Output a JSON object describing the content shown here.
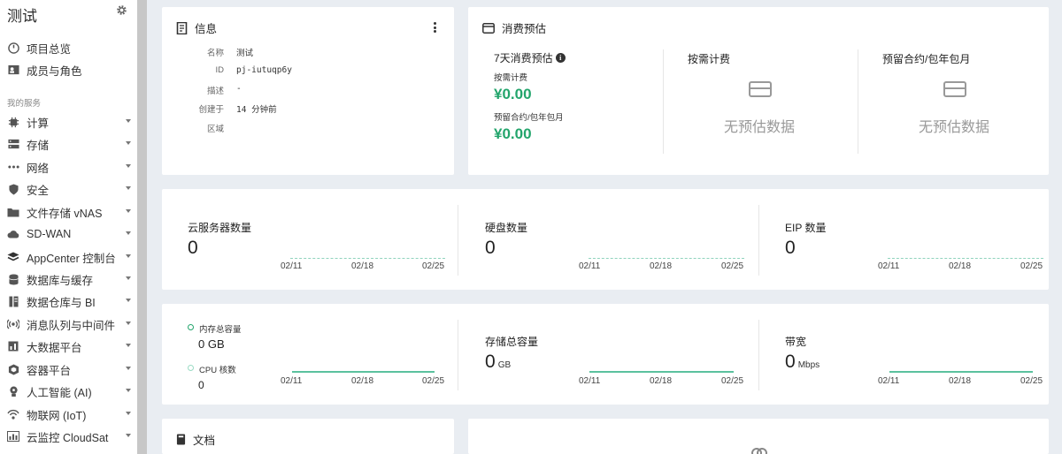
{
  "sidebar": {
    "project_title": "测试",
    "top_items": [
      {
        "label": "项目总览",
        "icon": "dashboard-icon"
      },
      {
        "label": "成员与角色",
        "icon": "members-icon"
      }
    ],
    "section_label": "我的服务",
    "services": [
      {
        "label": "计算",
        "icon": "cpu-icon"
      },
      {
        "label": "存储",
        "icon": "storage-icon"
      },
      {
        "label": "网络",
        "icon": "network-icon"
      },
      {
        "label": "安全",
        "icon": "shield-icon"
      },
      {
        "label": "文件存储 vNAS",
        "icon": "folder-icon"
      },
      {
        "label": "SD-WAN",
        "icon": "cloud-icon"
      },
      {
        "label": "AppCenter 控制台",
        "icon": "layers-icon"
      },
      {
        "label": "数据库与缓存",
        "icon": "database-icon"
      },
      {
        "label": "数据仓库与 BI",
        "icon": "warehouse-icon"
      },
      {
        "label": "消息队列与中间件",
        "icon": "broadcast-icon"
      },
      {
        "label": "大数据平台",
        "icon": "bar-chart-icon"
      },
      {
        "label": "容器平台",
        "icon": "container-icon"
      },
      {
        "label": "人工智能 (AI)",
        "icon": "ai-icon"
      },
      {
        "label": "物联网 (IoT)",
        "icon": "iot-icon"
      },
      {
        "label": "云监控 CloudSat",
        "icon": "monitor-icon"
      }
    ]
  },
  "info": {
    "title": "信息",
    "rows": [
      {
        "key": "名称",
        "value": "测试"
      },
      {
        "key": "ID",
        "value": "pj-iutuqp6y"
      },
      {
        "key": "描述",
        "value": "-"
      },
      {
        "key": "创建于",
        "value": "14 分钟前"
      },
      {
        "key": "区域",
        "value": ""
      }
    ]
  },
  "estimate": {
    "title": "消费预估",
    "seven_day_label": "7天消费预估",
    "ondemand_label": "按需计费",
    "ondemand_value": "¥0.00",
    "reserved_label": "预留合约/包年包月",
    "reserved_value": "¥0.00",
    "col2_title": "按需计费",
    "col3_title": "预留合约/包年包月",
    "no_data": "无预估数据"
  },
  "counts": [
    {
      "title": "云服务器数量",
      "value": "0"
    },
    {
      "title": "硬盘数量",
      "value": "0"
    },
    {
      "title": "EIP 数量",
      "value": "0"
    }
  ],
  "x_ticks": [
    "02/11",
    "02/18",
    "02/25"
  ],
  "capacity": {
    "memory_label": "内存总容量",
    "memory_value": "0 GB",
    "cpu_label": "CPU 核数",
    "cpu_value": "0",
    "storage_title": "存储总容量",
    "storage_value": "0",
    "storage_unit": "GB",
    "bandwidth_title": "带宽",
    "bandwidth_value": "0",
    "bandwidth_unit": "Mbps"
  },
  "docs": {
    "title": "文档"
  },
  "colors": {
    "accent_green": "#23a56c",
    "chart_line": "#5bc19e",
    "background": "#e9edf2"
  }
}
